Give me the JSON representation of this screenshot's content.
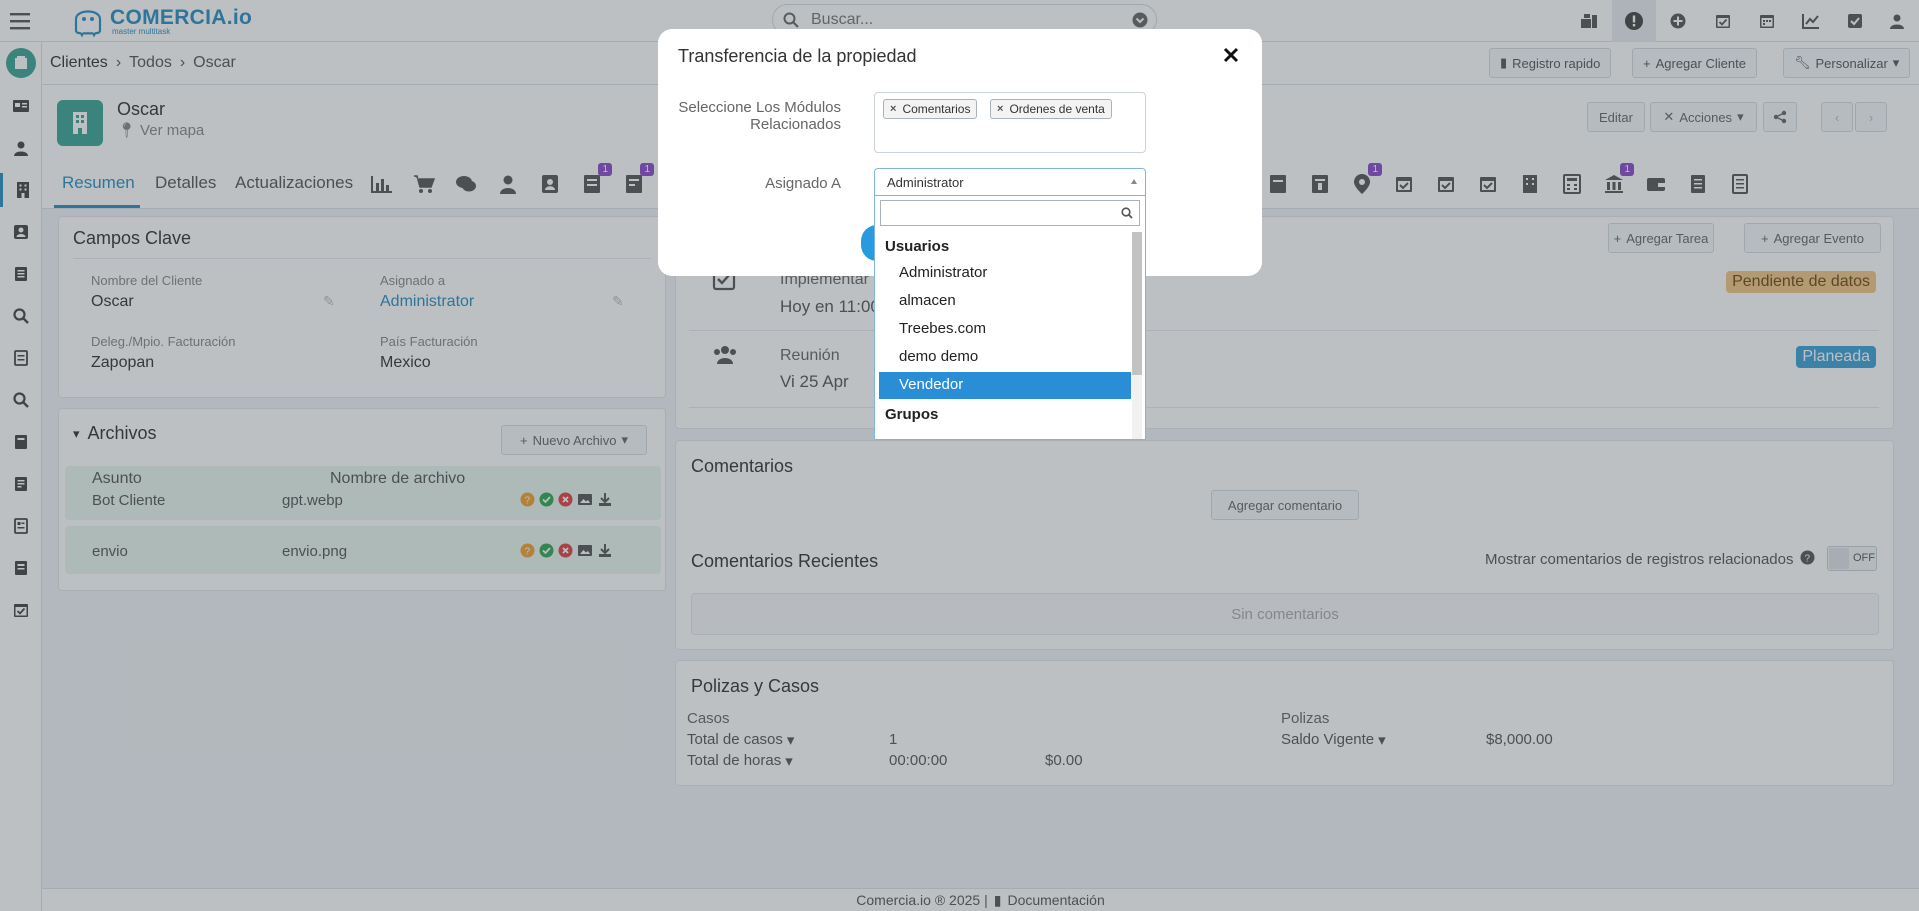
{
  "header": {
    "logo_name": "COMERCIA.io",
    "logo_tagline": "master multitask",
    "search_placeholder": "Buscar..."
  },
  "breadcrumb": {
    "module": "Clientes",
    "list": "Todos",
    "record": "Oscar"
  },
  "header_actions": {
    "quick_register": "Registro rapido",
    "add_client": "Agregar Cliente",
    "customize": "Personalizar"
  },
  "record": {
    "name": "Oscar",
    "map_link": "Ver mapa",
    "edit_label": "Editar",
    "actions_label": "Acciones"
  },
  "tabs": [
    {
      "label": "Resumen"
    },
    {
      "label": "Detalles"
    },
    {
      "label": "Actualizaciones"
    }
  ],
  "tab_badges": [
    "1",
    "1",
    "1",
    "1"
  ],
  "key_fields": {
    "title": "Campos Clave",
    "fields": [
      {
        "label": "Nombre del Cliente",
        "value": "Oscar"
      },
      {
        "label": "Asignado a",
        "value": "Administrator"
      },
      {
        "label": "Deleg./Mpio. Facturación",
        "value": "Zapopan"
      },
      {
        "label": "País Facturación",
        "value": "Mexico"
      }
    ]
  },
  "files": {
    "title": "Archivos",
    "new_button": "Nuevo Archivo",
    "col_subject": "Asunto",
    "col_filename": "Nombre de archivo",
    "rows": [
      {
        "subject": "Bot Cliente",
        "file": "gpt.webp"
      },
      {
        "subject": "envio",
        "file": "envio.png"
      }
    ]
  },
  "activities": {
    "add_task": "Agregar Tarea",
    "add_event": "Agregar Evento",
    "items": [
      {
        "title": "Implementar c",
        "when": "Hoy en 11:00",
        "status": "Pendiente de datos"
      },
      {
        "title": "Reunión",
        "when": "Vi 25 Apr",
        "status": "Planeada"
      }
    ]
  },
  "comments": {
    "title": "Comentarios",
    "add_button": "Agregar comentario",
    "recent_title": "Comentarios Recientes",
    "show_related": "Mostrar comentarios de registros relacionados",
    "toggle_state": "OFF",
    "empty": "Sin comentarios"
  },
  "policies": {
    "title": "Polizas y Casos",
    "cases_header": "Casos",
    "policies_header": "Polizas",
    "total_cases_label": "Total de casos",
    "total_cases_value": "1",
    "total_hours_label": "Total de horas",
    "total_hours_value": "00:00:00",
    "total_hours_amount": "$0.00",
    "balance_label": "Saldo Vigente",
    "balance_value": "$8,000.00"
  },
  "modal": {
    "title": "Transferencia de la propiedad",
    "modules_label_line1": "Seleccione Los Módulos",
    "modules_label_line2": "Relacionados",
    "selected_modules": [
      "Comentarios",
      "Ordenes de venta"
    ],
    "assigned_label": "Asignado A",
    "assigned_value": "Administrator",
    "dropdown": {
      "group_users": "Usuarios",
      "options": [
        "Administrator",
        "almacen",
        "Treebes.com",
        "demo demo",
        "Vendedor"
      ],
      "highlighted": "Vendedor",
      "group_groups": "Grupos"
    }
  },
  "footer": {
    "copyright": "Comercia.io ® 2025 |",
    "docs": "Documentación"
  },
  "colors": {
    "accent": "#2a8ec0",
    "brand_green": "#3aa595",
    "badge_purple": "#8a4bc8",
    "status_orange": "#f3c583",
    "status_blue": "#3aa2d6",
    "selected_option": "#2a8ed6"
  }
}
